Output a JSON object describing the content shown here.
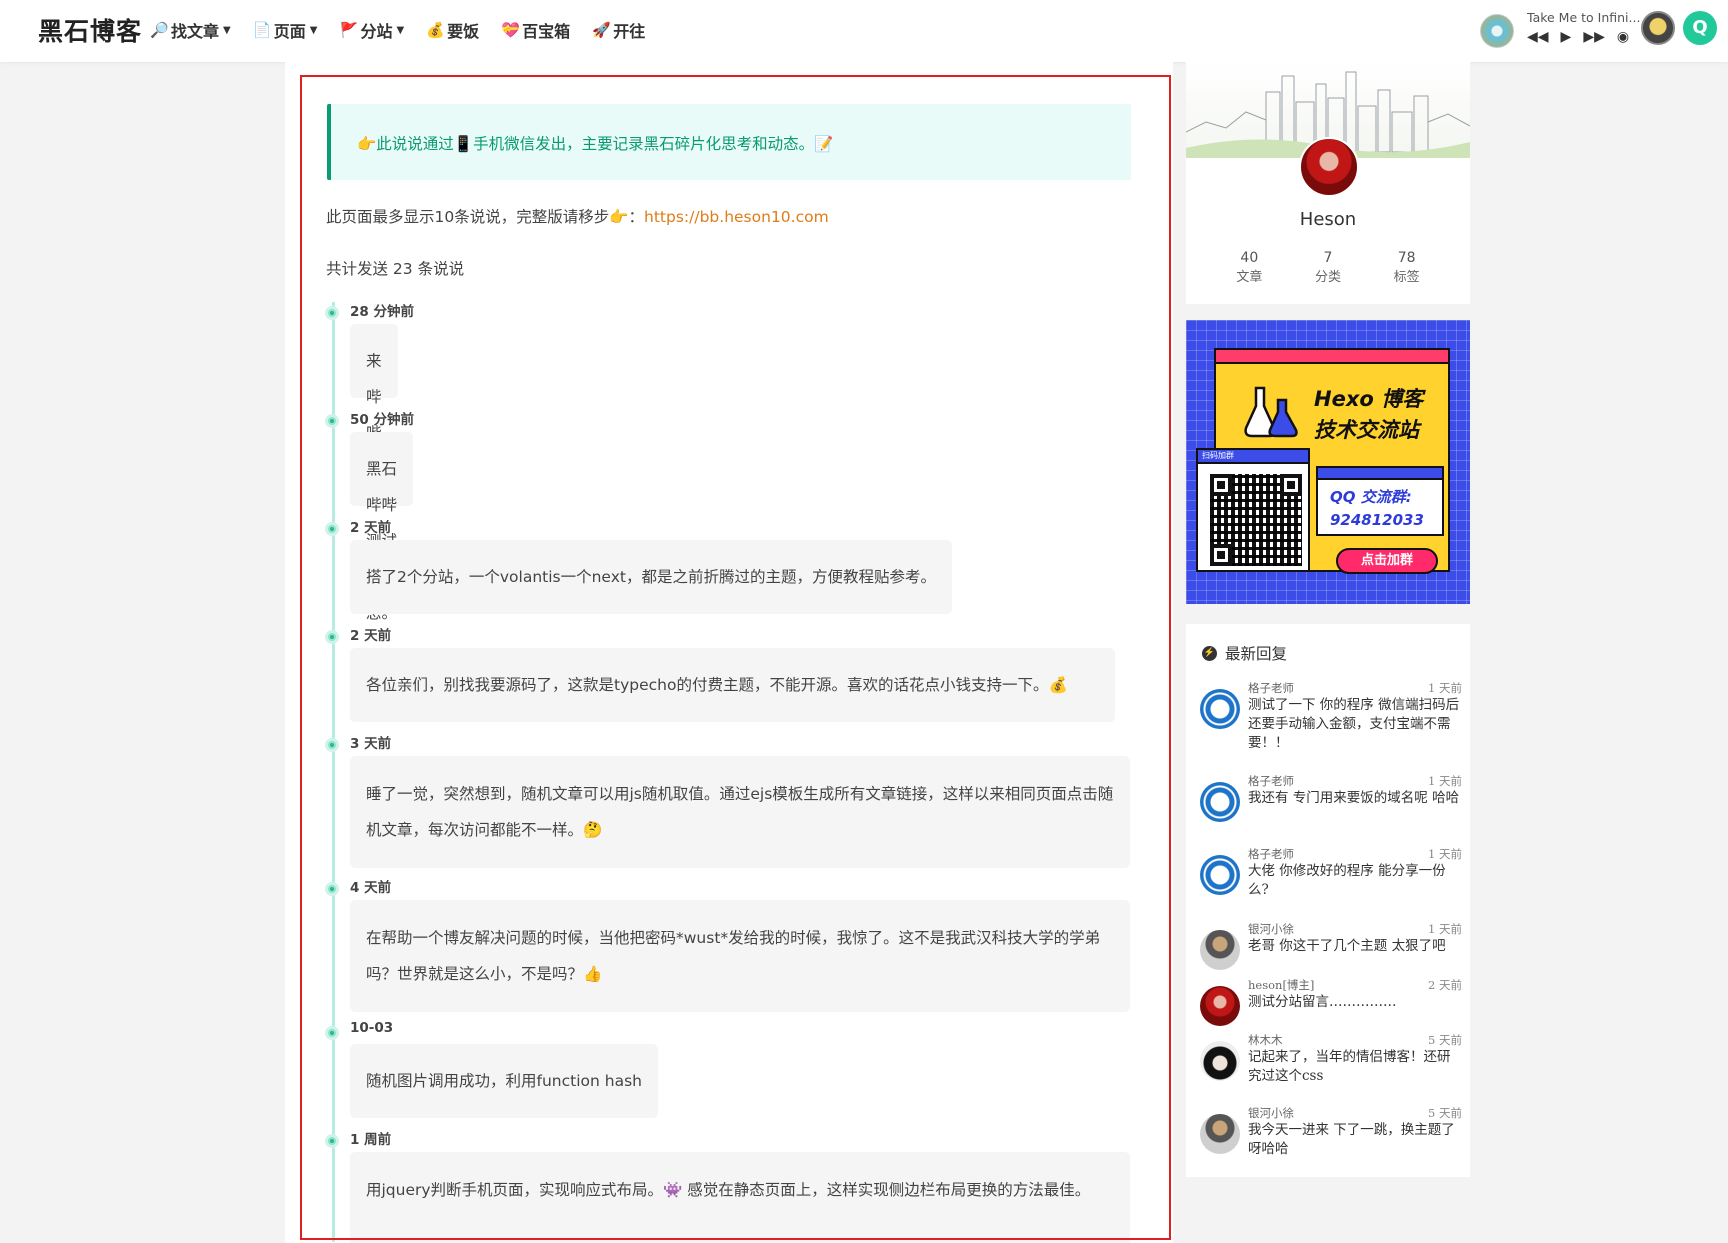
{
  "header": {
    "logo": "黑石博客",
    "nav": [
      {
        "icon": "🔎",
        "label": "找文章",
        "caret": true
      },
      {
        "icon": "📄",
        "label": "页面",
        "caret": true
      },
      {
        "icon": "🚩",
        "label": "分站",
        "caret": true
      },
      {
        "icon": "💰",
        "label": "要饭",
        "caret": false
      },
      {
        "icon": "💝",
        "label": "百宝箱",
        "caret": false
      },
      {
        "icon": "🚀",
        "label": "开往",
        "caret": false
      }
    ],
    "player": {
      "title": "Take Me to Infini...",
      "prev": "◀◀",
      "play": "▶",
      "next": "▶▶",
      "list": "◉"
    },
    "search_glyph": "Q"
  },
  "notice": "👉此说说通过📱手机微信发出，主要记录黑石碎片化思考和动态。📝",
  "intro": {
    "text": "此页面最多显示10条说说，完整版请移步👉：",
    "link": "https://bb.heson10.com"
  },
  "count_text": "共计发送 23 条说说",
  "timeline": [
    {
      "time": "28 分钟前",
      "text": "来哔哔了"
    },
    {
      "time": "50 分钟前",
      "text": "黑石哔哔测试消息。"
    },
    {
      "time": "2 天前",
      "text": "搭了2个分站，一个volantis一个next，都是之前折腾过的主题，方便教程贴参考。"
    },
    {
      "time": "2 天前",
      "text": "各位亲们，别找我要源码了，这款是typecho的付费主题，不能开源。喜欢的话花点小钱支持一下。💰"
    },
    {
      "time": "3 天前",
      "text": "睡了一觉，突然想到，随机文章可以用js随机取值。通过ejs模板生成所有文章链接，这样以来相同页面点击随机文章，每次访问都能不一样。🤔"
    },
    {
      "time": "4 天前",
      "text": "在帮助一个博友解决问题的时候，当他把密码*wust*发给我的时候，我惊了。这不是我武汉科技大学的学弟吗？世界就是这么小，不是吗？👍"
    },
    {
      "time": "10-03",
      "text": "随机图片调用成功，利用function hash"
    },
    {
      "time": "1 周前",
      "text": "用jquery判断手机页面，实现响应式布局。👾 感觉在静态页面上，这样实现侧边栏布局更换的方法最佳。"
    }
  ],
  "profile": {
    "name": "Heson",
    "stats": [
      {
        "value": "40",
        "label": "文章"
      },
      {
        "value": "7",
        "label": "分类"
      },
      {
        "value": "78",
        "label": "标签"
      }
    ]
  },
  "ad": {
    "title1": "Hexo 博客",
    "title2": "技术交流站",
    "qr_label": "扫码加群",
    "qq1": "QQ 交流群:",
    "qq2": "924812033",
    "button": "点击加群"
  },
  "recent": {
    "title": "最新回复",
    "comments": [
      {
        "name": "格子老师",
        "time": "1 天前",
        "text": "测试了一下 你的程序 微信端扫码后还要手动输入金额，支付宝端不需要！！",
        "avatar": "blue"
      },
      {
        "name": "格子老师",
        "time": "1 天前",
        "text": "我还有 专门用来要饭的域名呢 哈哈",
        "avatar": "blue"
      },
      {
        "name": "格子老师",
        "time": "1 天前",
        "text": "大佬 你修改好的程序 能分享一份么?",
        "avatar": "blue"
      },
      {
        "name": "银河小徐",
        "time": "1 天前",
        "text": "老哥 你这干了几个主题 太狠了吧",
        "avatar": "gray"
      },
      {
        "name": "heson[博主]",
        "time": "2 天前",
        "text": "测试分站留言……………",
        "avatar": "red"
      },
      {
        "name": "林木木",
        "time": "5 天前",
        "text": "记起来了，当年的情侣博客！还研究过这个css",
        "avatar": "black"
      },
      {
        "name": "银河小徐",
        "time": "5 天前",
        "text": "我今天一进来 下了一跳，换主题了呀哈哈",
        "avatar": "gray"
      }
    ]
  }
}
